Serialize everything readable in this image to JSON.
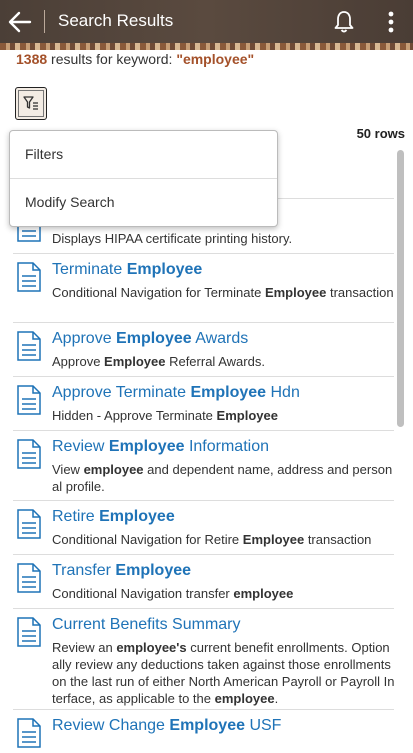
{
  "header": {
    "title": "Search Results"
  },
  "summary": {
    "count": "1388",
    "text": " results for keyword: ",
    "keyword": "\"employee\""
  },
  "rows_label": "50 rows",
  "menu": {
    "items": [
      "Filters",
      "Modify Search"
    ]
  },
  "partial_row_1": {
    "visible_title_fragment": "loyee"
  },
  "partial_row_2": {
    "description": "Displays HIPAA certificate printing history."
  },
  "results": [
    {
      "title_pre": "Terminate ",
      "title_bold": "Employee",
      "title_post": "",
      "desc_parts": [
        "Conditional Navigation for Terminate ",
        "Employee",
        " transaction"
      ]
    },
    {
      "title_pre": "Approve ",
      "title_bold": "Employee",
      "title_post": " Awards",
      "desc_parts": [
        "Approve ",
        "Employee",
        " Referral Awards."
      ]
    },
    {
      "title_pre": "Approve Terminate ",
      "title_bold": "Employee",
      "title_post": " Hdn",
      "desc_parts": [
        "Hidden - Approve Terminate ",
        "Employee",
        ""
      ]
    },
    {
      "title_pre": "Review ",
      "title_bold": "Employee",
      "title_post": " Information",
      "desc_parts": [
        "View ",
        "employee",
        " and dependent name, address and personal profile."
      ]
    },
    {
      "title_pre": "Retire ",
      "title_bold": "Employee",
      "title_post": "",
      "desc_parts": [
        "Conditional Navigation for Retire ",
        "Employee",
        " transaction"
      ]
    },
    {
      "title_pre": "Transfer ",
      "title_bold": "Employee",
      "title_post": "",
      "desc_parts": [
        "Conditional Navigation transfer ",
        "employee",
        ""
      ]
    },
    {
      "title_pre": "Current Benefits Summary",
      "title_bold": "",
      "title_post": "",
      "desc_parts": [
        "Review an ",
        "employee's",
        " current benefit enrollments. Optionally review any deductions taken against those enrollments on the last run of either North American Payroll or Payroll Interface, as applicable to the ",
        "employee",
        "."
      ]
    },
    {
      "title_pre": "Review Change ",
      "title_bold": "Employee",
      "title_post": " USF",
      "desc_parts": []
    }
  ]
}
